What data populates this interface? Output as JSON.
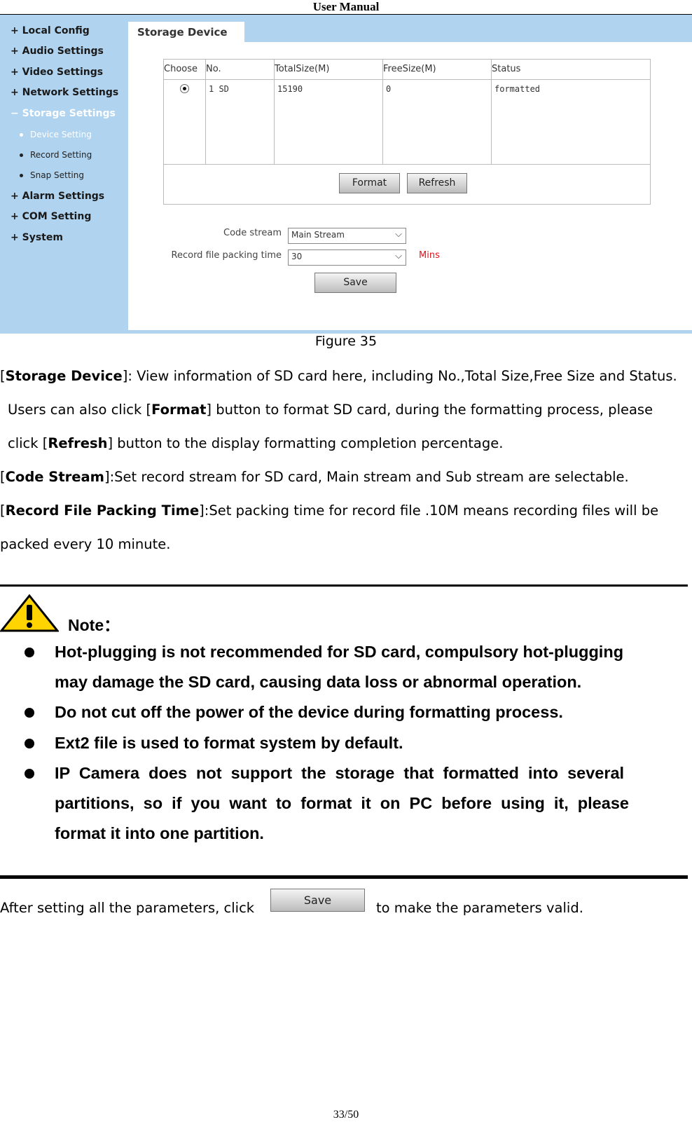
{
  "header": {
    "title": "User Manual"
  },
  "sidebar": {
    "items": [
      "+ Local Config",
      "+ Audio Settings",
      "+ Video Settings",
      "+ Network Settings",
      "− Storage Settings",
      "Device Setting",
      "Record Setting",
      "Snap Setting",
      "+ Alarm Settings",
      "+ COM Setting",
      "+ System"
    ]
  },
  "tab": "Storage Device",
  "table": {
    "headers": [
      "Choose",
      "No.",
      "TotalSize(M)",
      "FreeSize(M)",
      "Status"
    ],
    "rows": [
      {
        "selected": true,
        "no": "1 SD",
        "total": "15190",
        "free": "0",
        "status": "formatted"
      }
    ]
  },
  "buttons": {
    "format": "Format",
    "refresh": "Refresh",
    "save": "Save"
  },
  "form": {
    "code_stream_label": "Code stream",
    "code_stream_value": "Main Stream",
    "packing_label": "Record file packing time",
    "packing_value": "30",
    "packing_unit": "Mins"
  },
  "caption": "Figure 35",
  "body": [
    {
      "b": "Storage Device",
      "t": "]: View information of SD card here, including No.,Total Size,Free Size and Status."
    },
    {
      "pre": "Users can also click [",
      "b": "Format",
      "t": "] button to format SD card, during the formatting process, please"
    },
    {
      "pre": "click [",
      "b": "Refresh",
      "t": "] button to the display formatting completion percentage."
    },
    {
      "b": "Code Stream",
      "t": "]:Set record stream for SD card, Main stream and Sub stream are selectable."
    },
    {
      "b": "Record File Packing Time",
      "t": "]:Set packing time for record file .10M means recording files will be"
    },
    {
      "t": "packed every 10 minute."
    }
  ],
  "note": {
    "title": "Note：",
    "lines": [
      "Hot-plugging is not recommended for SD card, compulsory hot-plugging",
      "may damage the SD card, causing data loss or abnormal operation.",
      "Do not cut off the power of the device during formatting process.",
      "Ext2 file is used to format system by default.",
      "IP  Camera  does  not  support  the  storage  that  formatted  into  several",
      "partitions,  so  if  you  want  to  format  it  on  PC  before  using  it,  please",
      "format it into one partition."
    ]
  },
  "footer_text": {
    "before": "After setting all the parameters, click",
    "after": "to make the parameters valid.",
    "button": "Save"
  },
  "page_number": "33/50"
}
